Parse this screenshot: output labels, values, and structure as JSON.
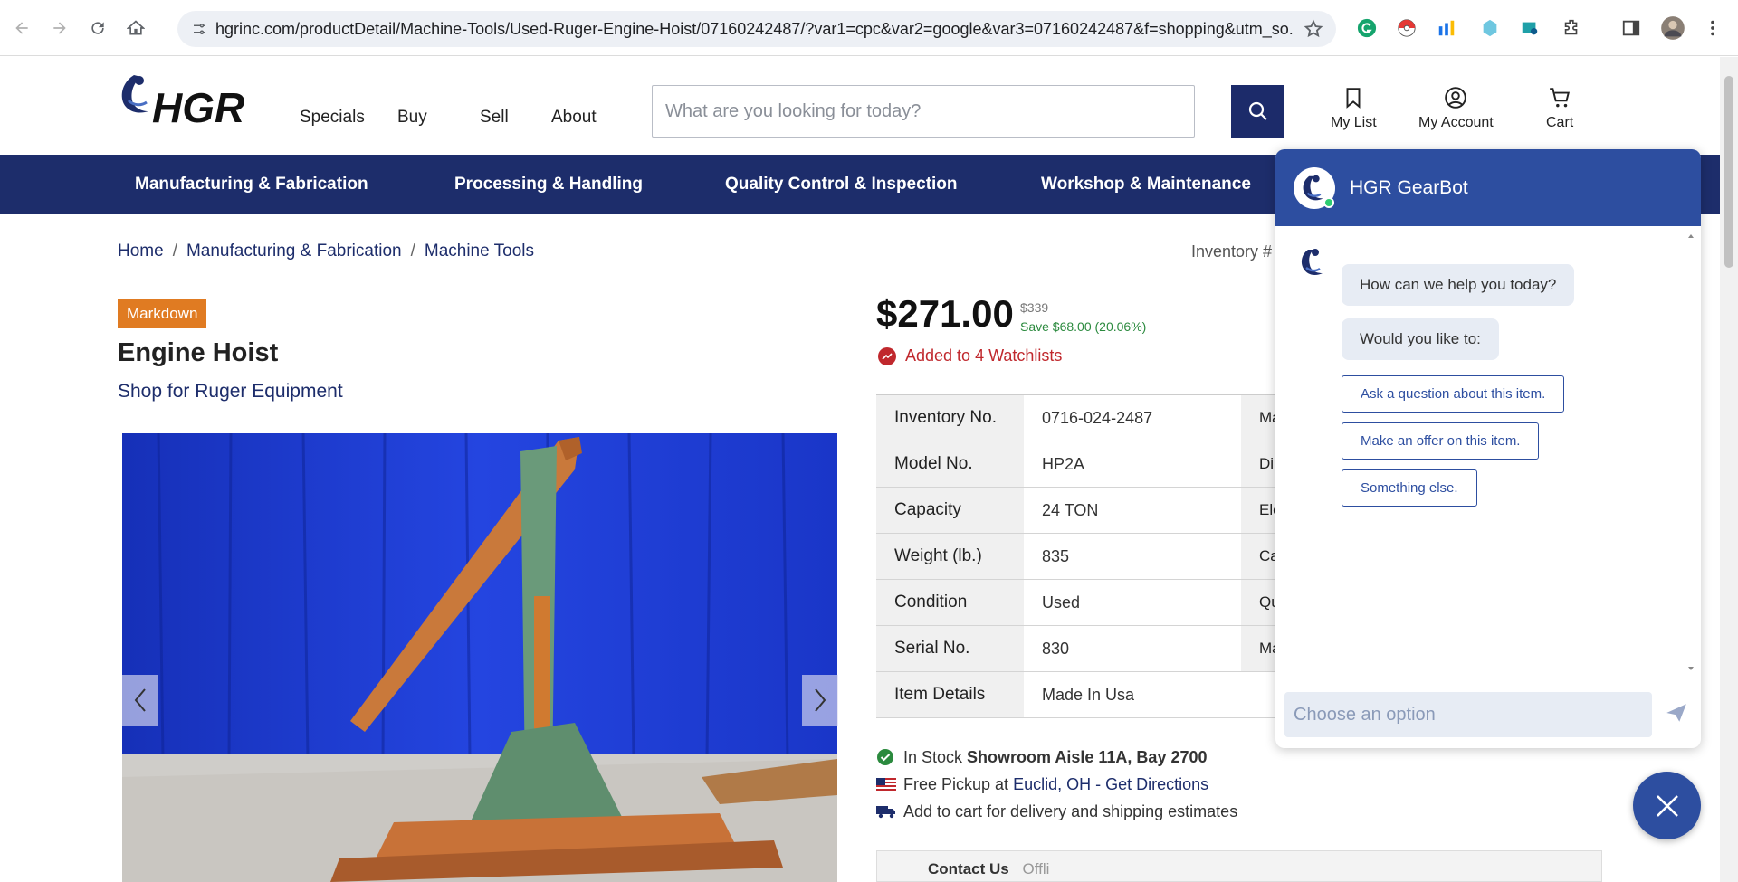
{
  "browser": {
    "url": "hgrinc.com/productDetail/Machine-Tools/Used-Ruger-Engine-Hoist/07160242487/?var1=cpc&var2=google&var3=07160242487&f=shopping&utm_so..."
  },
  "header": {
    "logo_text": "HGR",
    "nav": [
      "Specials",
      "Buy",
      "Sell",
      "About"
    ],
    "search_placeholder": "What are you looking for today?",
    "my_list": "My List",
    "my_account": "My Account",
    "cart": "Cart"
  },
  "categories": [
    "Manufacturing & Fabrication",
    "Processing & Handling",
    "Quality Control & Inspection",
    "Workshop & Maintenance"
  ],
  "breadcrumb": [
    "Home",
    "Manufacturing & Fabrication",
    "Machine Tools"
  ],
  "inventory_label": "Inventory #",
  "product": {
    "badge": "Markdown",
    "title": "Engine Hoist",
    "shop_link": "Shop for Ruger Equipment",
    "price": "$271.00",
    "old_price": "$339",
    "savings": "Save $68.00 (20.06%)",
    "watchlists": "Added to 4 Watchlists"
  },
  "specs": [
    {
      "label": "Inventory No.",
      "value": "0716-024-2487",
      "right_label": "Ma"
    },
    {
      "label": "Model No.",
      "value": "HP2A",
      "right_label": "Di"
    },
    {
      "label": "Capacity",
      "value": "24 TON",
      "right_label": "Ele"
    },
    {
      "label": "Weight (lb.)",
      "value": "835",
      "right_label": "Ca"
    },
    {
      "label": "Condition",
      "value": "Used",
      "right_label": "Qu"
    },
    {
      "label": "Serial No.",
      "value": "830",
      "right_label": "Ma"
    },
    {
      "label": "Item Details",
      "value": "Made In Usa",
      "right_label": ""
    }
  ],
  "availability": {
    "in_stock": "In Stock",
    "location": "Showroom Aisle 11A, Bay 2700",
    "pickup_prefix": "Free Pickup at",
    "pickup_city": "Euclid, OH",
    "pickup_sep": "-",
    "directions": "Get Directions",
    "shipping": "Add to cart for delivery and shipping estimates"
  },
  "contact": {
    "label": "Contact Us",
    "status": "Offli"
  },
  "chat": {
    "name": "HGR GearBot",
    "messages": [
      "How can we help you today?",
      "Would you like to:"
    ],
    "options": [
      "Ask a question about this item.",
      "Make an offer on this item.",
      "Something else."
    ],
    "input_placeholder": "Choose an option"
  },
  "colors": {
    "brand_navy": "#1d2d6b",
    "chat_blue": "#2d4ea0",
    "markdown_orange": "#e07b22"
  }
}
